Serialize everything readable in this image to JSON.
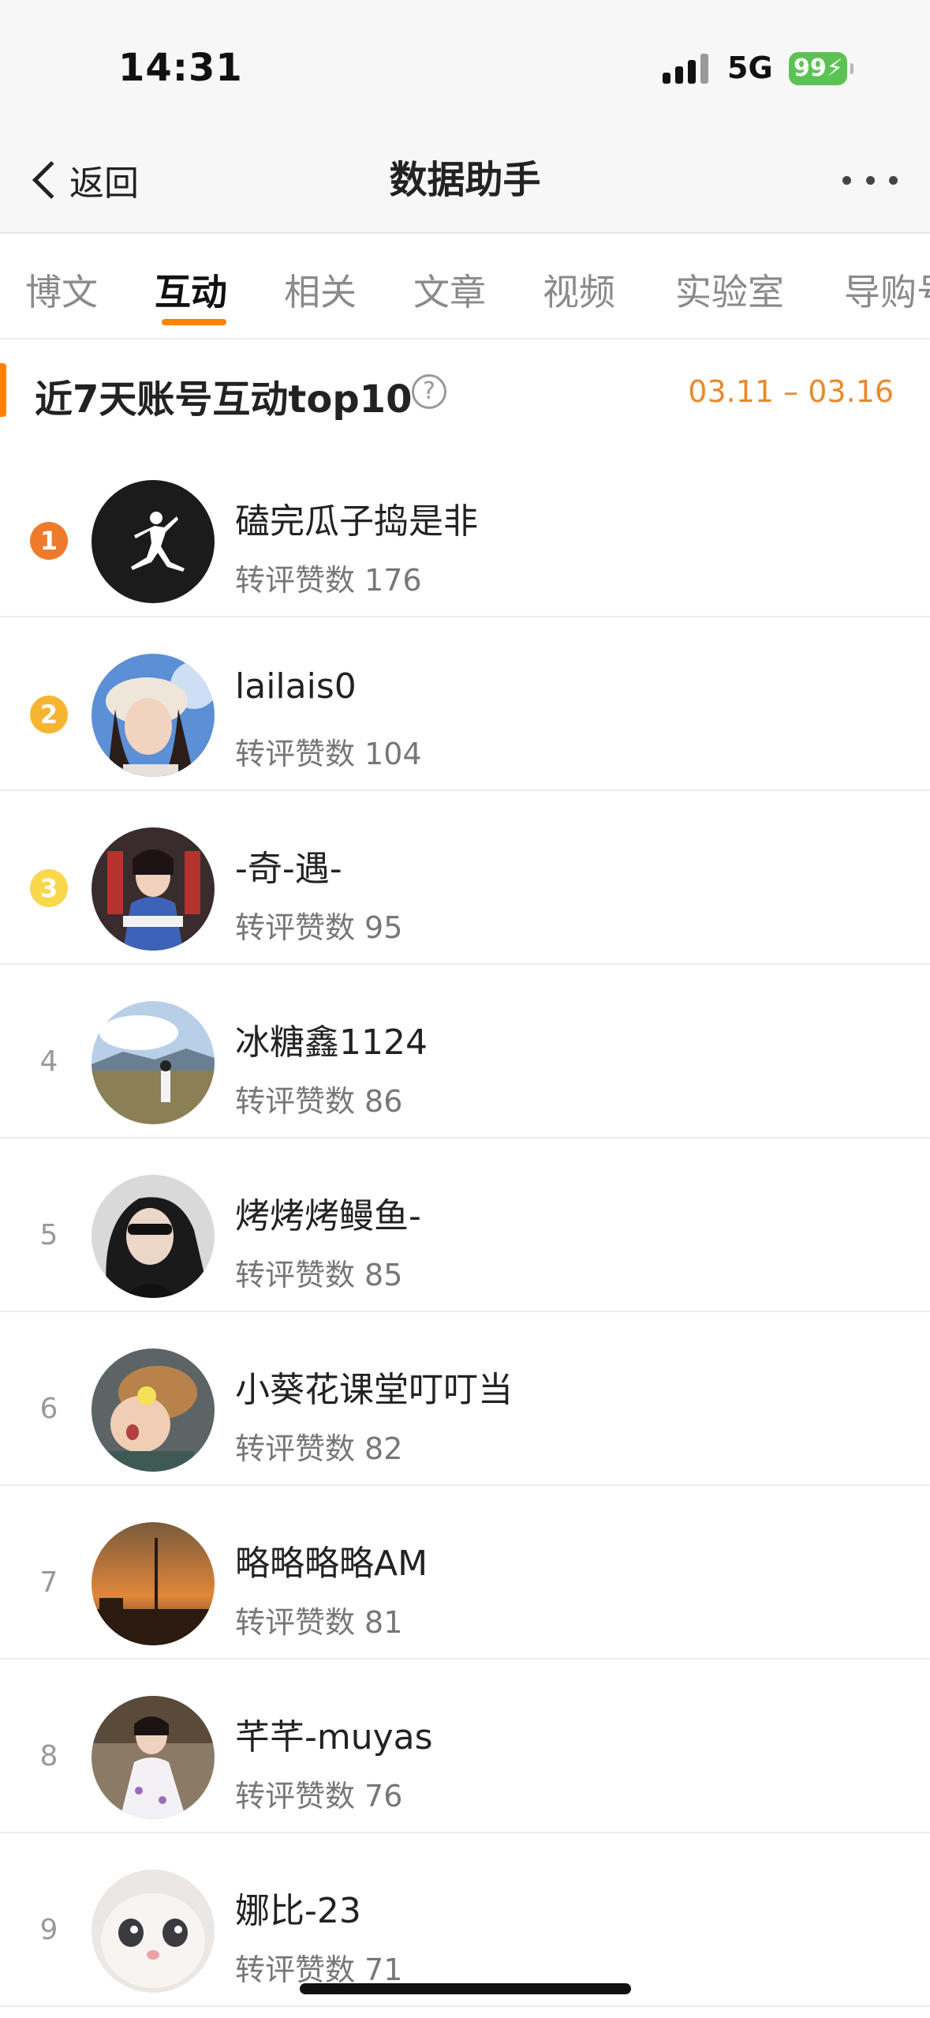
{
  "status_bar": {
    "time": "14:31",
    "network": "5G",
    "battery": "99"
  },
  "nav": {
    "back_label": "返回",
    "title": "数据助手"
  },
  "tabs": [
    {
      "label": "博文",
      "active": false
    },
    {
      "label": "互动",
      "active": true
    },
    {
      "label": "相关",
      "active": false
    },
    {
      "label": "文章",
      "active": false
    },
    {
      "label": "视频",
      "active": false
    },
    {
      "label": "实验室",
      "active": false
    },
    {
      "label": "导购号",
      "active": false
    }
  ],
  "section": {
    "title": "近7天账号互动top10",
    "date_range": "03.11 – 03.16",
    "accent": "#ff8200"
  },
  "list": {
    "stat_label": "转评赞数",
    "items": [
      {
        "rank": "1",
        "name": "磕完瓜子捣是非",
        "count": "176"
      },
      {
        "rank": "2",
        "name": "lailais0",
        "count": "104"
      },
      {
        "rank": "3",
        "name": "-奇-遇-",
        "count": "95"
      },
      {
        "rank": "4",
        "name": "冰糖鑫1124",
        "count": "86"
      },
      {
        "rank": "5",
        "name": "烤烤烤鳗鱼-",
        "count": "85"
      },
      {
        "rank": "6",
        "name": "小葵花课堂叮叮当",
        "count": "82"
      },
      {
        "rank": "7",
        "name": "略略略略AM",
        "count": "81"
      },
      {
        "rank": "8",
        "name": "芊芊-muyas",
        "count": "76"
      },
      {
        "rank": "9",
        "name": "娜比-23",
        "count": "71"
      }
    ]
  }
}
